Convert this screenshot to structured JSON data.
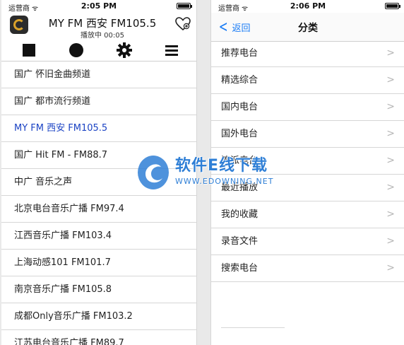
{
  "left_screen": {
    "status": {
      "carrier": "运营商",
      "time": "2:05 PM"
    },
    "header": {
      "station_title": "MY FM 西安 FM105.5",
      "play_status": "播放中 00:05"
    },
    "controls": [
      "stop-icon",
      "record-icon",
      "settings-gear-icon",
      "menu-icon"
    ],
    "stations": [
      {
        "name": "国广 怀旧金曲频道",
        "active": false
      },
      {
        "name": "国广 都市流行频道",
        "active": false
      },
      {
        "name": "MY FM 西安 FM105.5",
        "active": true
      },
      {
        "name": "国广 Hit FM - FM88.7",
        "active": false
      },
      {
        "name": "中广 音乐之声",
        "active": false
      },
      {
        "name": "北京电台音乐广播 FM97.4",
        "active": false
      },
      {
        "name": "江西音乐广播 FM103.4",
        "active": false
      },
      {
        "name": "上海动感101 FM101.7",
        "active": false
      },
      {
        "name": "南京音乐广播 FM105.8",
        "active": false
      },
      {
        "name": "成都Only音乐广播 FM103.2",
        "active": false
      },
      {
        "name": "江苏电台音乐广播 FM89.7",
        "active": false
      }
    ],
    "active_color": "#1b43c4"
  },
  "right_screen": {
    "status": {
      "carrier": "运营商",
      "time": "2:06 PM"
    },
    "nav": {
      "back_label": "返回",
      "title": "分类"
    },
    "categories": [
      "推荐电台",
      "精选综合",
      "国内电台",
      "国外电台",
      "流派电台",
      "最近播放",
      "我的收藏",
      "录音文件",
      "搜索电台"
    ],
    "accent_color": "#1a7cf5"
  },
  "watermark": {
    "main": "软件E线下载",
    "sub": "WWW.EDOWNING.NET"
  }
}
